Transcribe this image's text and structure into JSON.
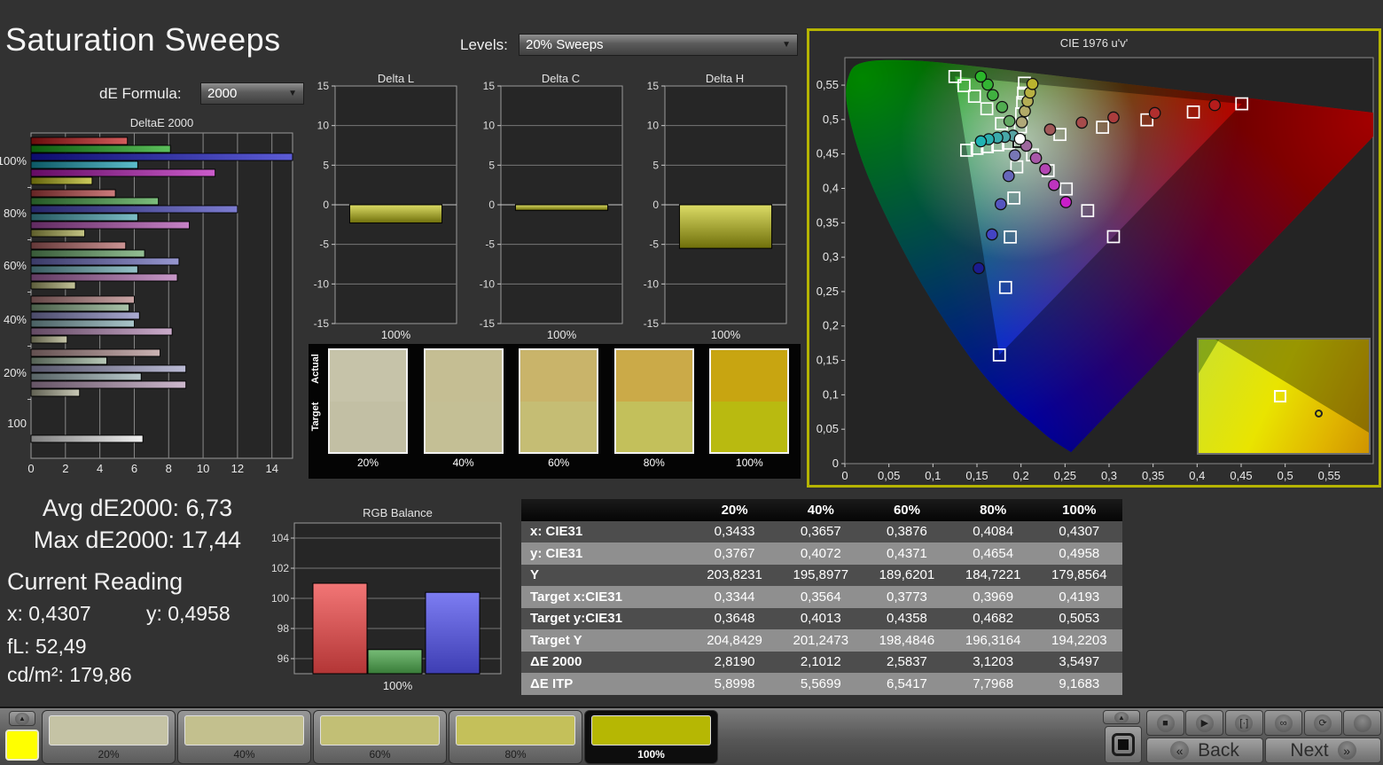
{
  "title": "Saturation Sweeps",
  "controls": {
    "de_formula_label": "dE Formula:",
    "de_formula_value": "2000",
    "levels_label": "Levels:",
    "levels_value": "20% Sweeps"
  },
  "summary": {
    "avg_line": "Avg dE2000: 6,73",
    "max_line": "Max dE2000: 17,44",
    "current_reading_title": "Current Reading",
    "x_line": "x: 0,4307",
    "y_line": "y: 0,4958",
    "fl_line": "fL: 52,49",
    "cd_line": "cd/m²: 179,86"
  },
  "swatch_strip": {
    "row_labels": [
      "Actual",
      "Target"
    ],
    "columns": [
      {
        "label": "20%",
        "actual": "#c6c3a9",
        "target": "#c2bfa4"
      },
      {
        "label": "40%",
        "actual": "#c5be93",
        "target": "#c4bf95"
      },
      {
        "label": "60%",
        "actual": "#c9b46a",
        "target": "#c5bd74"
      },
      {
        "label": "80%",
        "actual": "#cbaa48",
        "target": "#c3c05b"
      },
      {
        "label": "100%",
        "actual": "#c8a511",
        "target": "#b9ba10"
      }
    ]
  },
  "table": {
    "headers": [
      "",
      "20%",
      "40%",
      "60%",
      "80%",
      "100%"
    ],
    "rows": [
      {
        "label": "x: CIE31",
        "values": [
          "0,3433",
          "0,3657",
          "0,3876",
          "0,4084",
          "0,4307"
        ]
      },
      {
        "label": "y: CIE31",
        "values": [
          "0,3767",
          "0,4072",
          "0,4371",
          "0,4654",
          "0,4958"
        ]
      },
      {
        "label": "Y",
        "values": [
          "203,8231",
          "195,8977",
          "189,6201",
          "184,7221",
          "179,8564"
        ]
      },
      {
        "label": "Target x:CIE31",
        "values": [
          "0,3344",
          "0,3564",
          "0,3773",
          "0,3969",
          "0,4193"
        ]
      },
      {
        "label": "Target y:CIE31",
        "values": [
          "0,3648",
          "0,4013",
          "0,4358",
          "0,4682",
          "0,5053"
        ]
      },
      {
        "label": "Target Y",
        "values": [
          "204,8429",
          "201,2473",
          "198,4846",
          "196,3164",
          "194,2203"
        ]
      },
      {
        "label": "ΔE 2000",
        "values": [
          "2,8190",
          "2,1012",
          "2,5837",
          "3,1203",
          "3,5497"
        ]
      },
      {
        "label": "ΔE ITP",
        "values": [
          "5,8998",
          "5,5699",
          "6,5417",
          "7,7968",
          "9,1683"
        ]
      }
    ]
  },
  "chart_data": [
    {
      "id": "deltae2000",
      "type": "bar",
      "orientation": "horizontal",
      "title": "DeltaE 2000",
      "xlim": [
        0,
        15.2
      ],
      "xticks": [
        0,
        2,
        4,
        6,
        8,
        10,
        12,
        14
      ],
      "groups": [
        {
          "label": "100%",
          "bars": [
            {
              "name": "red",
              "value": 5.6,
              "color": "#c01616"
            },
            {
              "name": "green",
              "value": 8.1,
              "color": "#16a516"
            },
            {
              "name": "blue",
              "value": 17.44,
              "clipped": true,
              "color": "#1616c6"
            },
            {
              "name": "cyan",
              "value": 6.2,
              "color": "#16a0b6"
            },
            {
              "name": "magenta",
              "value": 10.7,
              "color": "#b516b5"
            },
            {
              "name": "yellow",
              "value": 3.55,
              "color": "#b5b516"
            }
          ]
        },
        {
          "label": "80%",
          "bars": [
            {
              "name": "red",
              "value": 4.9,
              "color": "#b84444"
            },
            {
              "name": "green",
              "value": 7.4,
              "color": "#44a044"
            },
            {
              "name": "blue",
              "value": 12.0,
              "color": "#4444bc"
            },
            {
              "name": "cyan",
              "value": 6.2,
              "color": "#44a0ae"
            },
            {
              "name": "magenta",
              "value": 9.2,
              "color": "#ae4cae"
            },
            {
              "name": "yellow",
              "value": 3.12,
              "color": "#aaaa4e"
            }
          ]
        },
        {
          "label": "60%",
          "bars": [
            {
              "name": "red",
              "value": 5.5,
              "color": "#b66666"
            },
            {
              "name": "green",
              "value": 6.6,
              "color": "#66a466"
            },
            {
              "name": "blue",
              "value": 8.6,
              "color": "#6a6abc"
            },
            {
              "name": "cyan",
              "value": 6.2,
              "color": "#68a8b0"
            },
            {
              "name": "magenta",
              "value": 8.5,
              "color": "#b06cb0"
            },
            {
              "name": "yellow",
              "value": 2.58,
              "color": "#a9a96c"
            }
          ]
        },
        {
          "label": "40%",
          "bars": [
            {
              "name": "red",
              "value": 6.0,
              "color": "#b48080"
            },
            {
              "name": "green",
              "value": 5.7,
              "color": "#85ab85"
            },
            {
              "name": "blue",
              "value": 6.3,
              "color": "#8686be"
            },
            {
              "name": "cyan",
              "value": 6.0,
              "color": "#86aeb4"
            },
            {
              "name": "magenta",
              "value": 8.2,
              "color": "#b487b4"
            },
            {
              "name": "yellow",
              "value": 2.1,
              "color": "#adad84"
            }
          ]
        },
        {
          "label": "20%",
          "bars": [
            {
              "name": "red",
              "value": 7.5,
              "color": "#b49292"
            },
            {
              "name": "green",
              "value": 4.4,
              "color": "#98b198"
            },
            {
              "name": "blue",
              "value": 9.0,
              "color": "#9c9cc1"
            },
            {
              "name": "cyan",
              "value": 6.4,
              "color": "#9cb3b6"
            },
            {
              "name": "magenta",
              "value": 9.0,
              "color": "#b799b7"
            },
            {
              "name": "yellow",
              "value": 2.82,
              "color": "#b1b196"
            }
          ]
        },
        {
          "label": "100",
          "bars": [
            {
              "name": "white",
              "value": 6.5,
              "color": "#e9e9e9"
            }
          ]
        }
      ]
    },
    {
      "id": "delta_l",
      "type": "bar",
      "title": "Delta L",
      "ylim": [
        -15,
        15
      ],
      "yticks": [
        15,
        10,
        5,
        0,
        -5,
        -10,
        -15
      ],
      "category": "100%",
      "value": -2.3,
      "color": "#c9c913"
    },
    {
      "id": "delta_c",
      "type": "bar",
      "title": "Delta C",
      "ylim": [
        -15,
        15
      ],
      "yticks": [
        15,
        10,
        5,
        0,
        -5,
        -10,
        -15
      ],
      "category": "100%",
      "value": -0.7,
      "color": "#c9c913"
    },
    {
      "id": "delta_h",
      "type": "bar",
      "title": "Delta H",
      "ylim": [
        -15,
        15
      ],
      "yticks": [
        15,
        10,
        5,
        0,
        -5,
        -10,
        -15
      ],
      "category": "100%",
      "value": -5.5,
      "color": "#c9c913"
    },
    {
      "id": "rgb_balance",
      "type": "bar",
      "title": "RGB Balance",
      "ylim": [
        95,
        105
      ],
      "yticks": [
        104,
        102,
        100,
        98,
        96
      ],
      "category": "100%",
      "series": [
        {
          "name": "red",
          "value": 101.0,
          "color": "#ee4848"
        },
        {
          "name": "green",
          "value": 96.6,
          "color": "#4aa54a"
        },
        {
          "name": "blue",
          "value": 100.4,
          "color": "#5252ee"
        }
      ]
    },
    {
      "id": "cie1976",
      "type": "scatter",
      "title": "CIE 1976 u'v'",
      "xlim": [
        0,
        0.6
      ],
      "ylim": [
        0,
        0.59
      ],
      "ticks": [
        "0",
        "0,05",
        "0,1",
        "0,15",
        "0,2",
        "0,25",
        "0,3",
        "0,35",
        "0,4",
        "0,45",
        "0,5",
        "0,55"
      ],
      "tick_step": 0.05,
      "border_color": "#b5b400",
      "white_point": {
        "u": 0.1978,
        "v": 0.4683
      },
      "gamut": {
        "red": [
          0.4507,
          0.5229
        ],
        "green": [
          0.125,
          0.5625
        ],
        "blue": [
          0.1754,
          0.1579
        ]
      },
      "targets": {
        "red": [
          [
            0.2442,
            0.4783
          ],
          [
            0.2926,
            0.4888
          ],
          [
            0.343,
            0.4996
          ],
          [
            0.3957,
            0.511
          ],
          [
            0.4507,
            0.5229
          ]
        ],
        "green": [
          [
            0.1778,
            0.4942
          ],
          [
            0.1612,
            0.5157
          ],
          [
            0.1472,
            0.5338
          ],
          [
            0.1353,
            0.5492
          ],
          [
            0.125,
            0.5625
          ]
        ],
        "blue": [
          [
            0.1952,
            0.4313
          ],
          [
            0.1919,
            0.386
          ],
          [
            0.1878,
            0.3293
          ],
          [
            0.1825,
            0.256
          ],
          [
            0.1754,
            0.1579
          ]
        ],
        "cyan": [
          [
            0.1857,
            0.4657
          ],
          [
            0.1737,
            0.4632
          ],
          [
            0.1618,
            0.4606
          ],
          [
            0.1501,
            0.4581
          ],
          [
            0.1383,
            0.4554
          ]
        ],
        "magenta": [
          [
            0.2131,
            0.4486
          ],
          [
            0.2308,
            0.4257
          ],
          [
            0.2514,
            0.3991
          ],
          [
            0.2757,
            0.3676
          ],
          [
            0.305,
            0.3298
          ]
        ],
        "yellow": [
          [
            0.1994,
            0.4894
          ],
          [
            0.2007,
            0.5085
          ],
          [
            0.2019,
            0.5247
          ],
          [
            0.2029,
            0.5385
          ],
          [
            0.2039,
            0.5529
          ]
        ],
        "white": [
          [
            0.1978,
            0.4683
          ]
        ]
      },
      "measured": {
        "red": {
          "points": [
            [
              0.233,
              0.4855
            ],
            [
              0.269,
              0.4955
            ],
            [
              0.305,
              0.503
            ],
            [
              0.352,
              0.5095
            ],
            [
              0.42,
              0.521
            ]
          ],
          "colors": [
            "#a05858",
            "#a64b4b",
            "#ab3d3d",
            "#b02e2e",
            "#b51c1c"
          ]
        },
        "green": {
          "points": [
            [
              0.1869,
              0.4977
            ],
            [
              0.1785,
              0.5182
            ],
            [
              0.168,
              0.5355
            ],
            [
              0.1622,
              0.5508
            ],
            [
              0.1544,
              0.5625
            ]
          ],
          "colors": [
            "#64a964",
            "#50ad50",
            "#40b140",
            "#33b433",
            "#2ab72a"
          ]
        },
        "blue": {
          "points": [
            [
              0.193,
              0.448
            ],
            [
              0.186,
              0.418
            ],
            [
              0.177,
              0.377
            ],
            [
              0.167,
              0.333
            ],
            [
              0.152,
              0.284
            ]
          ],
          "colors": [
            "#7777b5",
            "#6666ba",
            "#5555bf",
            "#4444c4",
            "#1b1b8f"
          ]
        },
        "cyan": {
          "points": [
            [
              0.191,
              0.4766
            ],
            [
              0.1816,
              0.4749
            ],
            [
              0.1731,
              0.4736
            ],
            [
              0.1633,
              0.4714
            ],
            [
              0.1544,
              0.4684
            ]
          ],
          "colors": [
            "#57a3a3",
            "#48a8a8",
            "#3aacac",
            "#2cb0b0",
            "#20b4b4"
          ]
        },
        "magenta": {
          "points": [
            [
              0.206,
              0.462
            ],
            [
              0.217,
              0.444
            ],
            [
              0.2275,
              0.428
            ],
            [
              0.2375,
              0.405
            ],
            [
              0.251,
              0.38
            ]
          ],
          "colors": [
            "#9d679d",
            "#a857a8",
            "#b346b3",
            "#be34be",
            "#c91ec9"
          ]
        },
        "yellow": {
          "points": [
            [
              0.2009,
              0.4961
            ],
            [
              0.2044,
              0.5122
            ],
            [
              0.2075,
              0.5266
            ],
            [
              0.2103,
              0.5392
            ],
            [
              0.213,
              0.5517
            ]
          ],
          "colors": [
            "#b0a878",
            "#b2ab68",
            "#b5ae55",
            "#b8b142",
            "#bab42e"
          ]
        },
        "white": {
          "points": [
            [
              0.1988,
              0.4719
            ]
          ],
          "colors": [
            "#ffffff"
          ]
        }
      },
      "inset": {
        "square": [
          0.48,
          0.5
        ],
        "circle": [
          0.71,
          0.66
        ]
      }
    }
  ],
  "bottom_bar": {
    "current_color": "#ffff00",
    "patches": [
      {
        "label": "20%",
        "color": "#c5c3a5",
        "selected": false
      },
      {
        "label": "40%",
        "color": "#c3c08e",
        "selected": false
      },
      {
        "label": "60%",
        "color": "#c2bf75",
        "selected": false
      },
      {
        "label": "80%",
        "color": "#c4c05a",
        "selected": false
      },
      {
        "label": "100%",
        "color": "#b6b703",
        "selected": true
      }
    ],
    "transport": [
      {
        "name": "stop",
        "glyph": "■"
      },
      {
        "name": "play",
        "glyph": "▶"
      },
      {
        "name": "single-measure",
        "glyph": "[·]"
      },
      {
        "name": "continuous",
        "glyph": "∞"
      },
      {
        "name": "loop",
        "glyph": "⟳"
      },
      {
        "name": "blank",
        "glyph": ""
      }
    ],
    "back_chevron": "«",
    "back_label": "Back",
    "next_label": "Next",
    "next_chevron": "»"
  }
}
